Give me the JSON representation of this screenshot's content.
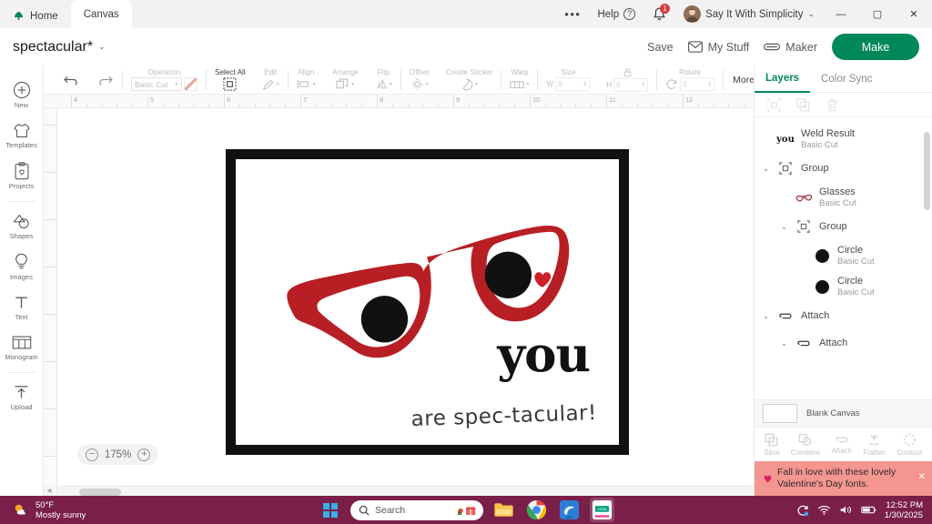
{
  "titlebar": {
    "tabs": [
      {
        "label": "Home",
        "icon": "cricut-leaf-icon",
        "active": false
      },
      {
        "label": "Canvas",
        "icon": "",
        "active": true
      }
    ],
    "overflow_label": "•••",
    "help_label": "Help",
    "notification_count": "1",
    "account_name": "Say It With Simplicity",
    "minimize_label": "—",
    "maximize_label": "▢",
    "close_label": "✕"
  },
  "header": {
    "project_title": "spectacular*",
    "save_label": "Save",
    "my_stuff_label": "My Stuff",
    "machine_label": "Maker",
    "make_label": "Make"
  },
  "toolbar": {
    "undo_label": "Undo",
    "redo_label": "Redo",
    "operation_label": "Operation",
    "operation_value": "Basic Cut",
    "select_all_label": "Select All",
    "edit_label": "Edit",
    "align_label": "Align",
    "arrange_label": "Arrange",
    "flip_label": "Flip",
    "offset_label": "Offset",
    "create_sticker_label": "Create Sticker",
    "warp_label": "Warp",
    "size_label": "Size",
    "width_label": "W",
    "width_value": "0",
    "height_label": "H",
    "height_value": "0",
    "rotate_label": "Rotate",
    "rotate_value": "0",
    "more_label": "More"
  },
  "leftnav": {
    "items": [
      {
        "label": "New",
        "icon": "plus-circle-icon"
      },
      {
        "label": "Templates",
        "icon": "shirt-icon"
      },
      {
        "label": "Projects",
        "icon": "clipboard-heart-icon"
      },
      {
        "label": "Shapes",
        "icon": "shapes-icon"
      },
      {
        "label": "Images",
        "icon": "lightbulb-icon"
      },
      {
        "label": "Text",
        "icon": "text-t-icon"
      },
      {
        "label": "Monogram",
        "icon": "monogram-icon"
      },
      {
        "label": "Upload",
        "icon": "upload-arrow-icon"
      }
    ]
  },
  "canvas": {
    "zoom_level": "175%",
    "zoom_out_label": "−",
    "zoom_in_label": "+",
    "ruler_h_ticks": [
      "4",
      "5",
      "6",
      "7",
      "8",
      "9",
      "10",
      "11",
      "12"
    ],
    "artwork": {
      "headline": "you",
      "tagline": "are spec-tacular!",
      "frame_color": "#111111",
      "glasses_color": "#b81f24",
      "pupil_color": "#111111",
      "heart_color": "#cc2026",
      "background_color": "#ffffff"
    }
  },
  "layers_panel": {
    "tabs": [
      {
        "label": "Layers",
        "active": true
      },
      {
        "label": "Color Sync",
        "active": false
      }
    ],
    "tools": [
      {
        "name": "ungroup-icon",
        "enabled": false
      },
      {
        "name": "duplicate-icon",
        "enabled": false
      },
      {
        "name": "delete-icon",
        "enabled": false
      }
    ],
    "layers": [
      {
        "name": "Weld Result",
        "sub": "Basic Cut",
        "indent": 0,
        "thumb": "you-text",
        "expander": ""
      },
      {
        "name": "Group",
        "sub": "",
        "indent": 0,
        "thumb": "group",
        "expander": "⌄"
      },
      {
        "name": "Glasses",
        "sub": "Basic Cut",
        "indent": 1,
        "thumb": "glasses",
        "expander": ""
      },
      {
        "name": "Group",
        "sub": "",
        "indent": 1,
        "thumb": "group",
        "expander": "⌄"
      },
      {
        "name": "Circle",
        "sub": "Basic Cut",
        "indent": 2,
        "thumb": "circle",
        "expander": ""
      },
      {
        "name": "Circle",
        "sub": "Basic Cut",
        "indent": 2,
        "thumb": "circle",
        "expander": ""
      },
      {
        "name": "Attach",
        "sub": "",
        "indent": 0,
        "thumb": "attach",
        "expander": "⌄"
      },
      {
        "name": "Attach",
        "sub": "",
        "indent": 1,
        "thumb": "attach",
        "expander": "⌄"
      }
    ],
    "blank_canvas_label": "Blank Canvas",
    "bottom_tools": [
      {
        "label": "Slice",
        "icon": "slice-icon"
      },
      {
        "label": "Combine",
        "icon": "combine-icon"
      },
      {
        "label": "Attach",
        "icon": "attach-icon"
      },
      {
        "label": "Flatten",
        "icon": "flatten-icon"
      },
      {
        "label": "Contour",
        "icon": "contour-icon"
      }
    ],
    "notice_text": "Fall in love with these lovely Valentine's Day fonts.",
    "notice_close_label": "✕",
    "notice_color": "#f4958f"
  },
  "taskbar": {
    "weather_temp": "50°F",
    "weather_desc": "Mostly sunny",
    "search_placeholder": "Search",
    "apps": [
      {
        "name": "file-explorer-icon"
      },
      {
        "name": "chrome-icon"
      },
      {
        "name": "edge-like-icon"
      },
      {
        "name": "cricut-design-space-icon"
      }
    ],
    "cricut_tile_label": "cricut",
    "clock_time": "12:52 PM",
    "clock_date": "1/30/2025"
  },
  "theme": {
    "accent_green": "#00885a",
    "taskbar_purple": "#7a1f4a",
    "red": "#b81f24"
  }
}
